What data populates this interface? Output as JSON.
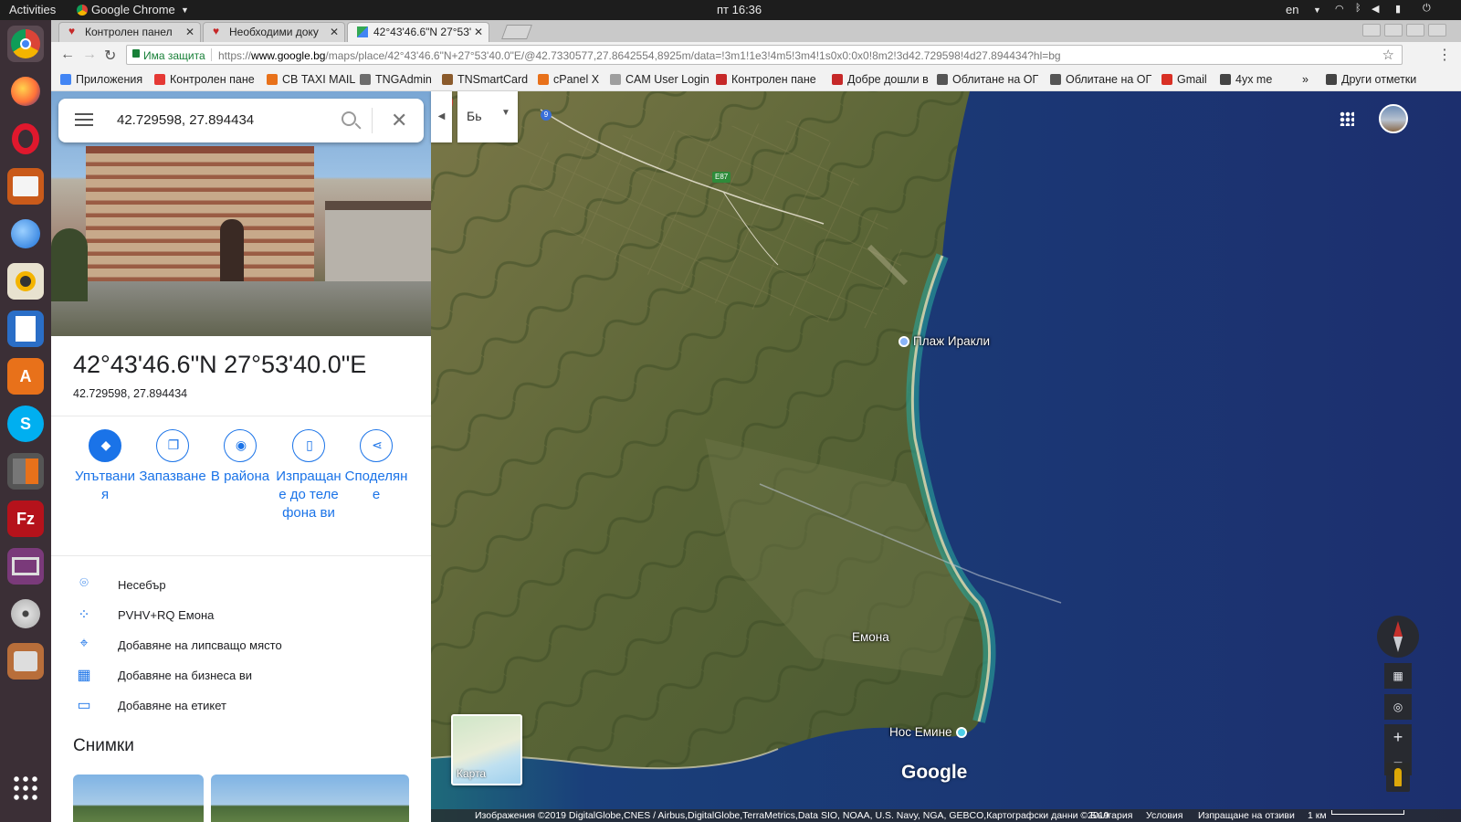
{
  "system": {
    "activities": "Activities",
    "app_name": "Google Chrome",
    "clock": "пт 16:36",
    "language": "en"
  },
  "dock": {
    "items": [
      "chrome-icon",
      "firefox-icon",
      "opera-icon",
      "files-icon",
      "thunderbird-icon",
      "rhythmbox-icon",
      "writer-icon",
      "software-center-icon",
      "skype-icon",
      "calculator-icon",
      "filezilla-icon",
      "video-editor-icon",
      "disc-icon",
      "system-tools-icon",
      "app-grid-icon"
    ]
  },
  "tabs": [
    {
      "label": "Контролен панел",
      "active": false
    },
    {
      "label": "Необходими доку",
      "active": false
    },
    {
      "label": "42°43'46.6\"N 27°53'",
      "active": true
    }
  ],
  "omnibox": {
    "secure_label": "Има защита",
    "url_prefix": "https://",
    "url_host": "www.google.bg",
    "url_path": "/maps/place/42°43'46.6\"N+27°53'40.0\"E/@42.7330577,27.8642554,8925m/data=!3m1!1e3!4m5!3m4!1s0x0:0x0!8m2!3d42.729598!4d27.894434?hl=bg"
  },
  "bookmarks": [
    {
      "label": "Приложения",
      "color": "#4285f4"
    },
    {
      "label": "Контролен пане",
      "color": "#e53935"
    },
    {
      "label": "СВ TAXI MAIL",
      "color": "#e8711a"
    },
    {
      "label": "TNGAdmin",
      "color": "#6d6d6d"
    },
    {
      "label": "TNSmartCard",
      "color": "#8a5a2b"
    },
    {
      "label": "cPanel X",
      "color": "#e8711a"
    },
    {
      "label": "CAM User Login",
      "color": "#9e9e9e"
    },
    {
      "label": "Контролен пане",
      "color": "#c62828"
    },
    {
      "label": "Добре дошли в",
      "color": "#c62828"
    },
    {
      "label": "Облитане на ОГ",
      "color": "#555555"
    },
    {
      "label": "Облитане на ОГ",
      "color": "#555555"
    },
    {
      "label": "Gmail",
      "color": "#d93025"
    },
    {
      "label": "4ух me",
      "color": "#444444"
    },
    {
      "label": "»",
      "color": ""
    },
    {
      "label": "Други отметки",
      "color": "#444444"
    }
  ],
  "search": {
    "query": "42.729598, 27.894434"
  },
  "place": {
    "title": "42°43'46.6\"N 27°53'40.0\"E",
    "coords": "42.729598, 27.894434"
  },
  "actions": [
    {
      "label": "Упътвания",
      "icon": "directions-icon",
      "glyph": "◆",
      "filled": true
    },
    {
      "label": "Запазване",
      "icon": "bookmark-icon",
      "glyph": "❐",
      "filled": false
    },
    {
      "label": "В района",
      "icon": "nearby-icon",
      "glyph": "◉",
      "filled": false
    },
    {
      "label": "Изпращане до телефона ви",
      "icon": "send-to-phone-icon",
      "glyph": "▯",
      "filled": false
    },
    {
      "label": "Споделяне",
      "icon": "share-icon",
      "glyph": "⋖",
      "filled": false
    }
  ],
  "info": [
    {
      "text": "Несебър",
      "icon": "location-pin-icon",
      "glyph": "⌾"
    },
    {
      "text": "PVHV+RQ Емона",
      "icon": "plus-code-icon",
      "glyph": "⁘"
    },
    {
      "text": "Добавяне на липсващо място",
      "icon": "add-place-icon",
      "glyph": "⌖"
    },
    {
      "text": "Добавяне на бизнеса ви",
      "icon": "add-business-icon",
      "glyph": "▦"
    },
    {
      "text": "Добавяне на етикет",
      "icon": "label-icon",
      "glyph": "▭"
    }
  ],
  "photos_title": "Снимки",
  "map": {
    "layer_button": "Бь",
    "labels": [
      "Плаж Иракли",
      "Емона",
      "Нос Емине"
    ],
    "road_labels": [
      "9",
      "E87"
    ],
    "minimap_label": "Карта",
    "logo": "Google",
    "attribution": "Изображения ©2019 DigitalGlobe,CNES / Airbus,DigitalGlobe,TerraMetrics,Data SIO, NOAA, U.S. Navy, NGA, GEBCO,Картографски данни ©2019",
    "country": "България",
    "terms": "Условия",
    "feedback": "Изпращане на отзиви",
    "scale": "1 км",
    "zoom_in": "+",
    "zoom_out": "−"
  }
}
